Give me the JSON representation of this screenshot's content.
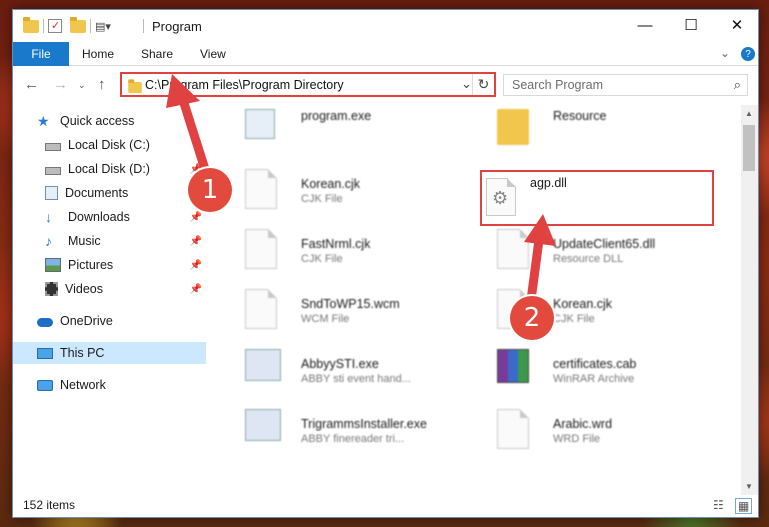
{
  "window": {
    "title": "Program",
    "controls": {
      "minimize": "—",
      "maximize": "☐",
      "close": "✕"
    }
  },
  "ribbon": {
    "tabs": [
      "File",
      "Home",
      "Share",
      "View"
    ],
    "collapse_icon": "chevron-down-icon",
    "help_icon": "help-icon"
  },
  "address_bar": {
    "path": "C:\\Program Files\\Program Directory",
    "search_placeholder": "Search Program"
  },
  "sidebar": {
    "items": [
      {
        "label": "Quick access",
        "icon": "star-icon"
      },
      {
        "label": "Local Disk (C:)",
        "icon": "drive-icon"
      },
      {
        "label": "Local Disk (D:)",
        "icon": "drive-icon"
      },
      {
        "label": "Documents",
        "icon": "documents-icon"
      },
      {
        "label": "Downloads",
        "icon": "download-icon"
      },
      {
        "label": "Music",
        "icon": "music-icon"
      },
      {
        "label": "Pictures",
        "icon": "pictures-icon"
      },
      {
        "label": "Videos",
        "icon": "videos-icon"
      },
      {
        "label": "OneDrive",
        "icon": "cloud-icon"
      },
      {
        "label": "This PC",
        "icon": "computer-icon"
      },
      {
        "label": "Network",
        "icon": "network-icon"
      }
    ]
  },
  "files": [
    {
      "name": "program.exe",
      "type": "",
      "icon": "exe-icon"
    },
    {
      "name": "Resource",
      "type": "",
      "icon": "folder-icon"
    },
    {
      "name": "Korean.cjk",
      "type": "CJK File",
      "icon": "document-icon"
    },
    {
      "name": "agp.dll",
      "type": "",
      "icon": "gear-file-icon"
    },
    {
      "name": "FastNrml.cjk",
      "type": "CJK File",
      "icon": "document-icon"
    },
    {
      "name": "UpdateClient65.dll",
      "type": "Resource DLL",
      "icon": "gear-file-icon"
    },
    {
      "name": "SndToWP15.wcm",
      "type": "WCM File",
      "icon": "document-icon"
    },
    {
      "name": "Korean.cjk",
      "type": "CJK File",
      "icon": "document-icon"
    },
    {
      "name": "AbbyySTI.exe",
      "type": "ABBY sti event hand...",
      "icon": "exe-icon"
    },
    {
      "name": "certificates.cab",
      "type": "WinRAR Archive",
      "icon": "winrar-icon"
    },
    {
      "name": "TrigrammsInstaller.exe",
      "type": "ABBY finereader tri...",
      "icon": "exe-icon"
    },
    {
      "name": "Arabic.wrd",
      "type": "WRD File",
      "icon": "document-icon"
    }
  ],
  "status": {
    "item_count": "152 items"
  },
  "annotations": {
    "step1": "1",
    "step2": "2",
    "color": "#e04141"
  }
}
